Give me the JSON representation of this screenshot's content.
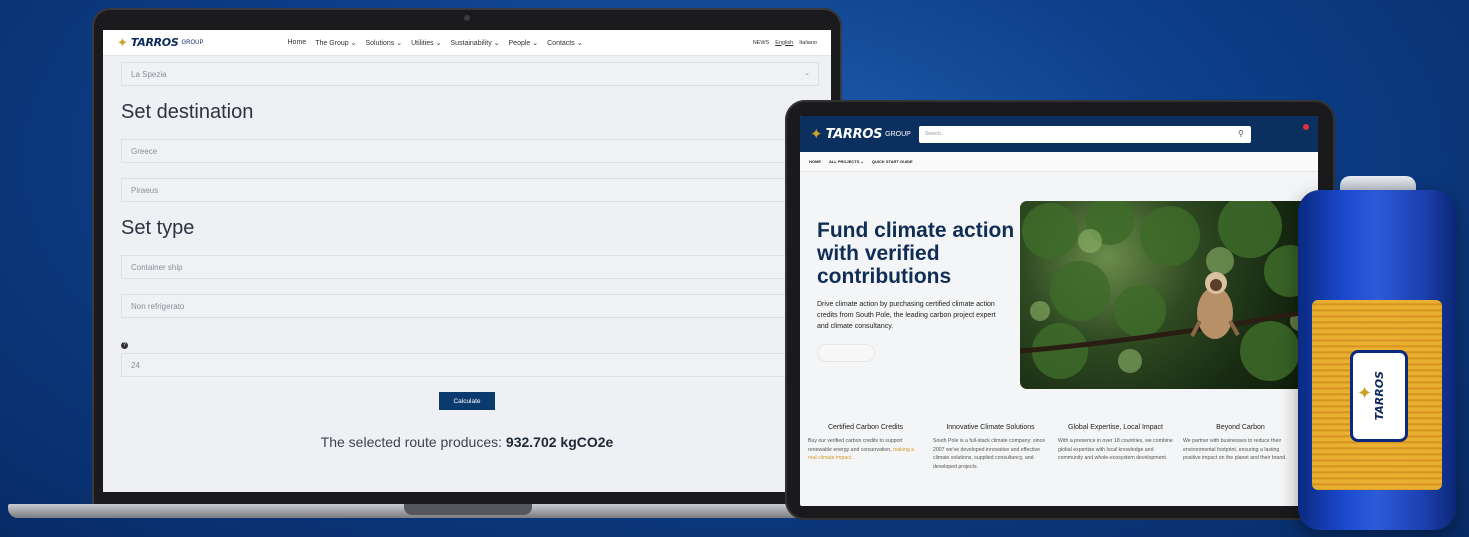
{
  "brand": {
    "name": "TARROS",
    "suffix": "GROUP"
  },
  "laptop": {
    "nav": {
      "items": [
        "Home",
        "The Group ⌄",
        "Solutions ⌄",
        "Utilities ⌄",
        "Sustainability ⌄",
        "People ⌄",
        "Contacts ⌄"
      ],
      "right": [
        "NEWS",
        "English",
        "Italiano"
      ]
    },
    "origin_port": "La Spezia",
    "destination": {
      "title": "Set destination",
      "country": "Greece",
      "port": "Piraeus"
    },
    "type": {
      "title": "Set type",
      "vessel": "Container ship",
      "refrigeration": "Non refrigerato",
      "value": "24"
    },
    "calculate_label": "Calculate",
    "result": {
      "prefix": "The selected route produces:",
      "value": "932.702 kgCO2e"
    }
  },
  "tablet": {
    "search_placeholder": "Search...",
    "subnav": [
      "HOME",
      "ALL PROJECTS ⌄",
      "QUICK START GUIDE"
    ],
    "hero": {
      "title": "Fund climate action with verified contributions",
      "text": "Drive climate action by purchasing certified climate action credits from South Pole, the leading carbon project expert and climate consultancy."
    },
    "features": [
      {
        "title": "Certified Carbon Credits",
        "text": "Buy our verified carbon credits to support renewable energy and conservation,",
        "highlight": "making a real climate impact."
      },
      {
        "title": "Innovative Climate Solutions",
        "text": "South Pole is a full-stack climate company: since 2007 we've developed innovative and effective climate solutions, supplied consultancy, and developed projects.",
        "highlight": ""
      },
      {
        "title": "Global Expertise, Local Impact",
        "text": "With a presence in over 18 countries, we combine global expertise with local knowledge and community and whole-ecosystem development.",
        "highlight": ""
      },
      {
        "title": "Beyond Carbon",
        "text": "We partner with businesses to reduce their environmental footprint, ensuring a lasting positive impact on the planet and their brand.",
        "highlight": ""
      }
    ]
  },
  "battery": {
    "label": "TARROS"
  },
  "colors": {
    "navy": "#0b2f5e",
    "accent": "#d49a2a",
    "background": "#0d3f8a"
  }
}
